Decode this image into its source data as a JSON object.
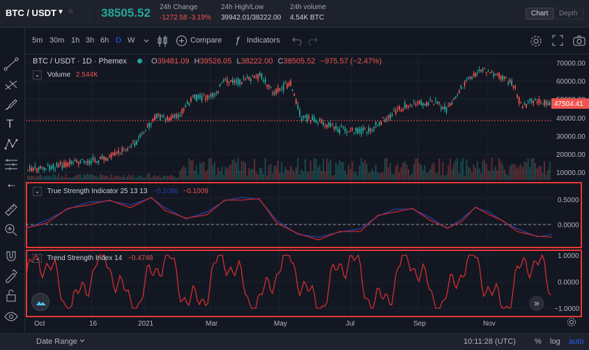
{
  "header": {
    "pair": "BTC / USDT",
    "last_price": "38505.52",
    "change_label": "24h Change",
    "change_value": "-1272.58 -3.19%",
    "highlow_label": "24h High/Low",
    "highlow_value": "39942.01/38222.00",
    "volume_label": "24h volume",
    "volume_value": "4.54K BTC",
    "view_tabs": [
      "Chart",
      "Depth"
    ]
  },
  "toolbar": {
    "timeframes": [
      "5m",
      "30m",
      "1h",
      "3h",
      "6h",
      "D",
      "W"
    ],
    "active_timeframe": "D",
    "compare_label": "Compare",
    "indicators_label": "Indicators"
  },
  "legend": {
    "symbol": "BTC / USDT · 1D · Phemex",
    "o_label": "O",
    "o": "39481.09",
    "h_label": "H",
    "h": "39526.05",
    "l_label": "L",
    "l": "38222.00",
    "c_label": "C",
    "c": "38505.52",
    "change": "−975.57 (−2.47%)",
    "volume_label": "Volume",
    "volume_value": "2.544K"
  },
  "panes": {
    "tsi_label": "True Strength Indicator 25 13 13",
    "tsi_value1": "−0.1086",
    "tsi_value2": "−0.1009",
    "trend_label": "Trend Strength Index 14",
    "trend_value": "−0.4748"
  },
  "price_axis": {
    "ticks": [
      "70000.00",
      "60000.00",
      "50000.00",
      "40000.00",
      "30000.00",
      "20000.00",
      "10000.00"
    ],
    "current_price_tag": "47504.41"
  },
  "tsi_axis": {
    "ticks": [
      "0.5000",
      "0.0000"
    ]
  },
  "trend_axis": {
    "ticks": [
      "1.0000",
      "0.0000",
      "−1.0000"
    ]
  },
  "time_axis": {
    "ticks": [
      "Oct",
      "16",
      "2021",
      "Mar",
      "May",
      "Jul",
      "Sep",
      "Nov"
    ]
  },
  "footer": {
    "date_range": "Date Range",
    "clock": "10:11:28 (UTC)",
    "percent": "%",
    "log": "log",
    "auto": "auto"
  },
  "colors": {
    "up": "#26a69a",
    "down": "#ef5350",
    "accent": "#2962ff",
    "highlight_border": "#e53935"
  }
}
